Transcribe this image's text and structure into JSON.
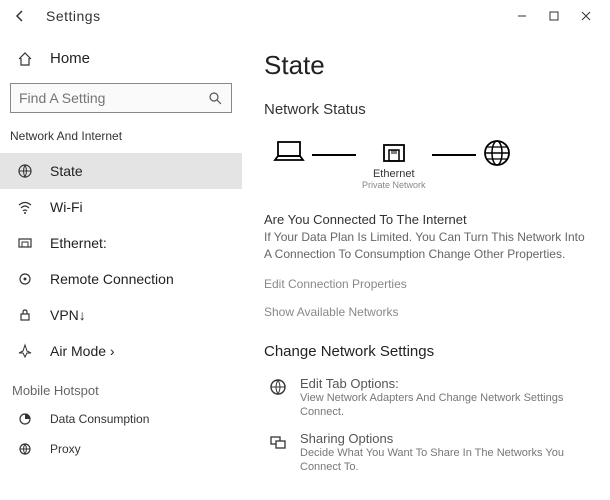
{
  "titlebar": {
    "title": "Settings"
  },
  "sidebar": {
    "home": "Home",
    "search_placeholder": "Find A Setting",
    "section": "Network And Internet",
    "items": [
      {
        "label": "State"
      },
      {
        "label": "Wi-Fi"
      },
      {
        "label": "Ethernet:"
      },
      {
        "label": "Remote Connection"
      },
      {
        "label": "VPN↓"
      },
      {
        "label": "Air Mode ›"
      }
    ],
    "subsection": "Mobile Hotspot",
    "subitems": [
      {
        "label": "Data Consumption"
      },
      {
        "label": "Proxy"
      }
    ]
  },
  "main": {
    "heading": "State",
    "status_heading": "Network Status",
    "diagram": {
      "mid_label": "Ethernet",
      "mid_sub": "Private Network"
    },
    "connected_title": "Are You Connected To The Internet",
    "connected_desc": "If Your Data Plan Is Limited. You Can Turn This Network Into A Connection To Consumption Change Other Properties.",
    "link_edit": "Edit Connection Properties",
    "link_show": "Show Available Networks",
    "change_heading": "Change Network Settings",
    "opt1_title": "Edit Tab Options:",
    "opt1_desc": "View Network Adapters And Change Network Settings Connect.",
    "opt2_title": "Sharing Options",
    "opt2_desc": "Decide What You Want To Share In The Networks You Connect To."
  }
}
